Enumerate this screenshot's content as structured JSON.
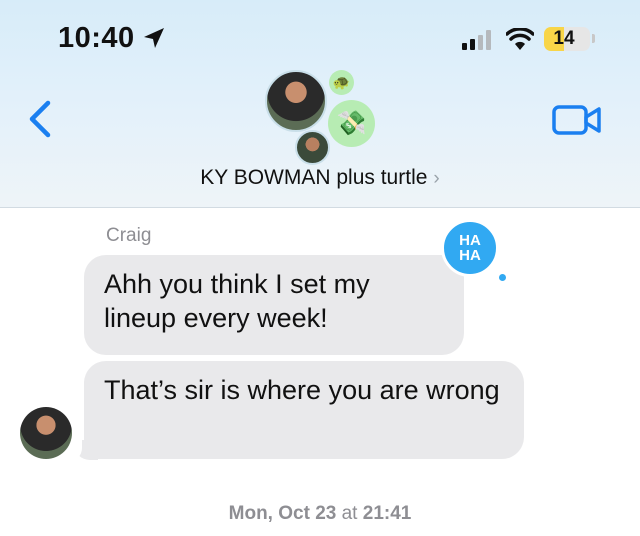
{
  "status_bar": {
    "time": "10:40",
    "battery": "14",
    "battery_level": 0.14,
    "icons": [
      "location-arrow-icon",
      "signal-icon",
      "wifi-icon",
      "battery-icon"
    ]
  },
  "header": {
    "group_name": "KY BOWMAN plus turtle",
    "chevron": "›",
    "avatars": [
      "user-photo-avatar",
      "turtle-emoji-avatar",
      "money-emoji-avatar",
      "user-photo-small-avatar"
    ],
    "back_icon": "chevron-left-icon",
    "video_icon": "video-camera-icon",
    "accent_color": "#1a7ff0"
  },
  "conversation": {
    "sender": "Craig",
    "messages": [
      {
        "text": "Ahh you think I set my lineup every week!",
        "reaction": "HA HA"
      },
      {
        "text": "That’s sir is where you are wrong"
      }
    ],
    "timestamp_day": "Mon, Oct 23",
    "timestamp_at": "at",
    "timestamp_time": "21:41"
  }
}
